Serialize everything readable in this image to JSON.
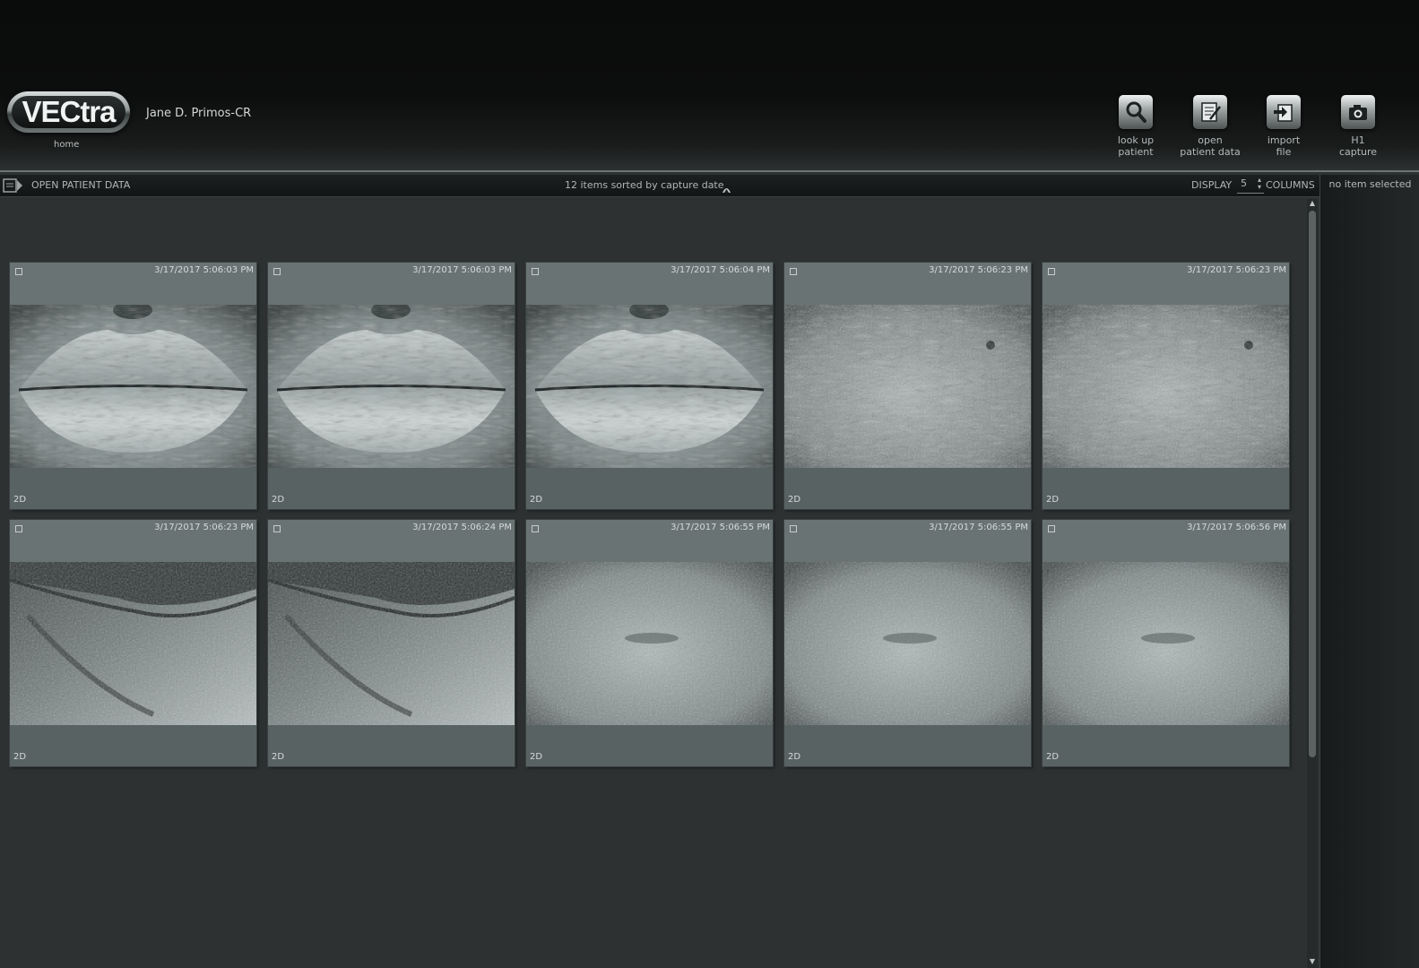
{
  "header": {
    "logo_text": "VECtra",
    "home_label": "home",
    "patient_name": "Jane D. Primos-CR",
    "tools": [
      {
        "line1": "look up",
        "line2": "patient",
        "icon": "magnifier-icon"
      },
      {
        "line1": "open",
        "line2": "patient data",
        "icon": "notepad-icon"
      },
      {
        "line1": "import",
        "line2": "file",
        "icon": "import-icon"
      },
      {
        "line1": "H1",
        "line2": "capture",
        "icon": "camera-icon"
      }
    ]
  },
  "toolbar": {
    "open_label": "OPEN PATIENT DATA",
    "sort_text": "12 items sorted by capture date",
    "display_label": "DISPLAY",
    "columns_value": "5",
    "columns_label": "COLUMNS"
  },
  "right_panel": {
    "status": "no item selected"
  },
  "items": [
    {
      "date": "3/17/2017 5:06:03 PM",
      "kind": "2D",
      "subject": "lips"
    },
    {
      "date": "3/17/2017 5:06:03 PM",
      "kind": "2D",
      "subject": "lips"
    },
    {
      "date": "3/17/2017 5:06:04 PM",
      "kind": "2D",
      "subject": "lips"
    },
    {
      "date": "3/17/2017 5:06:23 PM",
      "kind": "2D",
      "subject": "skin"
    },
    {
      "date": "3/17/2017 5:06:23 PM",
      "kind": "2D",
      "subject": "skin"
    },
    {
      "date": "3/17/2017 5:06:23 PM",
      "kind": "2D",
      "subject": "mouth-corner"
    },
    {
      "date": "3/17/2017 5:06:24 PM",
      "kind": "2D",
      "subject": "mouth-corner"
    },
    {
      "date": "3/17/2017 5:06:55 PM",
      "kind": "2D",
      "subject": "skin-flat"
    },
    {
      "date": "3/17/2017 5:06:55 PM",
      "kind": "2D",
      "subject": "skin-flat"
    },
    {
      "date": "3/17/2017 5:06:56 PM",
      "kind": "2D",
      "subject": "skin-flat"
    }
  ]
}
